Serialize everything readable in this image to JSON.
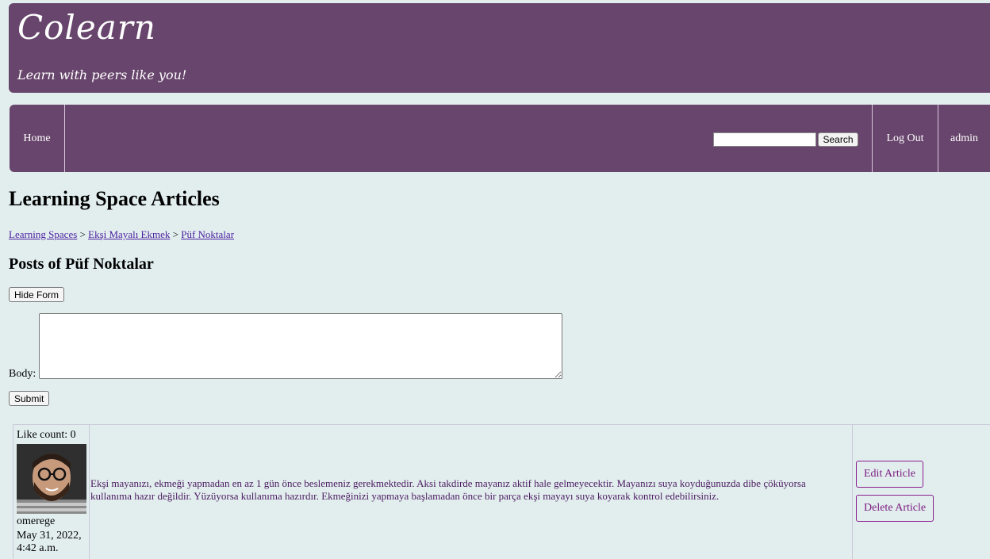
{
  "header": {
    "brand": "Colearn",
    "tagline": "Learn with peers like you!"
  },
  "nav": {
    "home": "Home",
    "search_button": "Search",
    "search_value": "",
    "logout": "Log Out",
    "user": "admin"
  },
  "page": {
    "title": "Learning Space Articles",
    "breadcrumb": [
      "Learning Spaces",
      "Ekşi Mayalı Ekmek",
      "Püf Noktalar"
    ],
    "breadcrumb_separator": ">",
    "section_title": "Posts of Püf Noktalar"
  },
  "form": {
    "hide_button": "Hide Form",
    "body_label": "Body:",
    "body_value": "",
    "submit_button": "Submit"
  },
  "article": {
    "like_label": "Like count: 0",
    "author": "omerege",
    "date": "May 31, 2022, 4:42 a.m.",
    "body": "Ekşi mayanızı, ekmeği yapmadan en az 1 gün önce beslemeniz gerekmektedir. Aksi takdirde mayanız aktif hale gelmeyecektir. Mayanızı suya koyduğunuzda dibe çöküyorsa kullanıma hazır değildir. Yüzüyorsa kullanıma hazırdır. Ekmeğinizi yapmaya başlamadan önce bir parça ekşi mayayı suya koyarak kontrol edebilirsiniz.",
    "edit_button": "Edit Article",
    "delete_button": "Delete Article"
  },
  "colors": {
    "brand": "#68456c",
    "background": "#e2eeee",
    "article_text": "#4a1a60",
    "action_border": "#8b1d8f"
  }
}
